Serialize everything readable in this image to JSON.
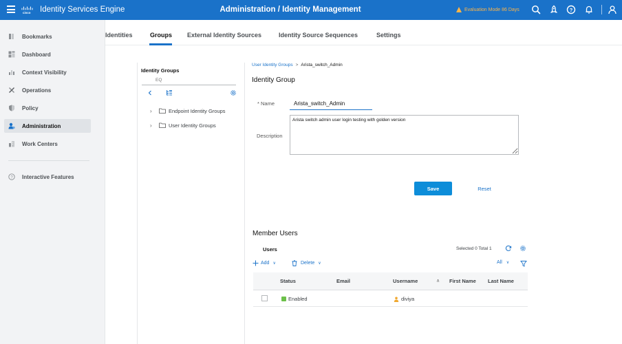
{
  "header": {
    "app_title": "Identity Services Engine",
    "page_title": "Administration / Identity Management",
    "evaluation": "Evaluation Mode 86 Days"
  },
  "sidebar": {
    "items": [
      {
        "label": "Bookmarks",
        "icon": "bookmark-icon"
      },
      {
        "label": "Dashboard",
        "icon": "dashboard-icon"
      },
      {
        "label": "Context Visibility",
        "icon": "context-visibility-icon"
      },
      {
        "label": "Operations",
        "icon": "wrench-icon"
      },
      {
        "label": "Policy",
        "icon": "shield-icon"
      },
      {
        "label": "Administration",
        "icon": "admin-user-icon",
        "active": true
      },
      {
        "label": "Work Centers",
        "icon": "work-centers-icon"
      },
      {
        "label": "Interactive Features",
        "icon": "help-circle-icon"
      }
    ]
  },
  "tabs": [
    {
      "label": "Identities"
    },
    {
      "label": "Groups",
      "active": true
    },
    {
      "label": "External Identity Sources"
    },
    {
      "label": "Identity Source Sequences"
    },
    {
      "label": "Settings"
    }
  ],
  "tree": {
    "title": "Identity Groups",
    "search_placeholder": "EQ",
    "nodes": [
      {
        "label": "Endpoint Identity Groups"
      },
      {
        "label": "User Identity Groups"
      }
    ]
  },
  "breadcrumb": {
    "parent": "User Identity Groups",
    "separator": ">",
    "current": "Arista_switch_Admin"
  },
  "form": {
    "title": "Identity Group",
    "name_label": "* Name",
    "name_value": "Arista_switch_Admin",
    "description_label": "Description",
    "description_value": "Arista switch admin user login testing with golden version",
    "save_label": "Save",
    "reset_label": "Reset"
  },
  "members": {
    "title": "Member Users",
    "subtitle": "Users",
    "selected_text": "Selected 0  Total 1",
    "add_label": "Add",
    "delete_label": "Delete",
    "filter_label": "All",
    "columns": [
      "Status",
      "Email",
      "Username",
      "First Name",
      "Last Name"
    ],
    "rows": [
      {
        "status": "Enabled",
        "email": "",
        "username": "diviya",
        "first_name": "",
        "last_name": ""
      }
    ]
  },
  "colors": {
    "brand_blue": "#1a72c9",
    "primary_button": "#0d8dd9",
    "warning": "#ffb547",
    "enabled_green": "#6cc04a"
  }
}
